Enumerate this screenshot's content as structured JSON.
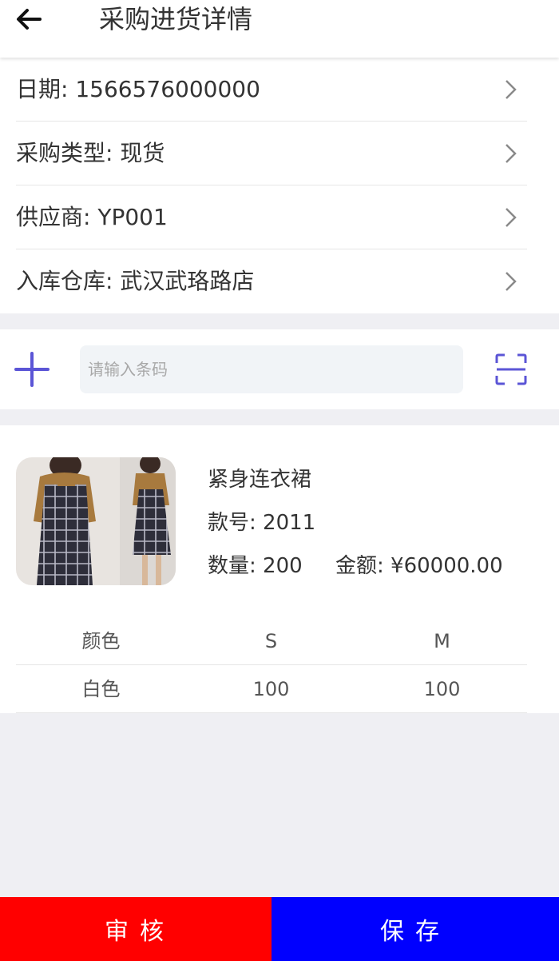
{
  "header": {
    "title": "采购进货详情",
    "back_icon": "arrow-left-icon"
  },
  "info_rows": [
    {
      "label": "日期: 1566576000000"
    },
    {
      "label": "采购类型: 现货"
    },
    {
      "label": "供应商: YP001"
    },
    {
      "label": "入库仓库: 武汉武珞路店"
    }
  ],
  "barcode": {
    "placeholder": "请输入条码",
    "add_icon": "plus-icon",
    "scan_icon": "scan-icon",
    "accent": "#5b55d6"
  },
  "product": {
    "name": "紧身连衣裙",
    "code": "款号: 2011",
    "quantity": "数量: 200",
    "amount": "金额: ¥60000.00",
    "size_table": {
      "headers": [
        "颜色",
        "S",
        "M"
      ],
      "rows": [
        [
          "白色",
          "100",
          "100"
        ]
      ]
    }
  },
  "actions": {
    "audit_label": "审核",
    "save_label": "保存",
    "audit_color": "#ff0000",
    "save_color": "#0000ff"
  }
}
